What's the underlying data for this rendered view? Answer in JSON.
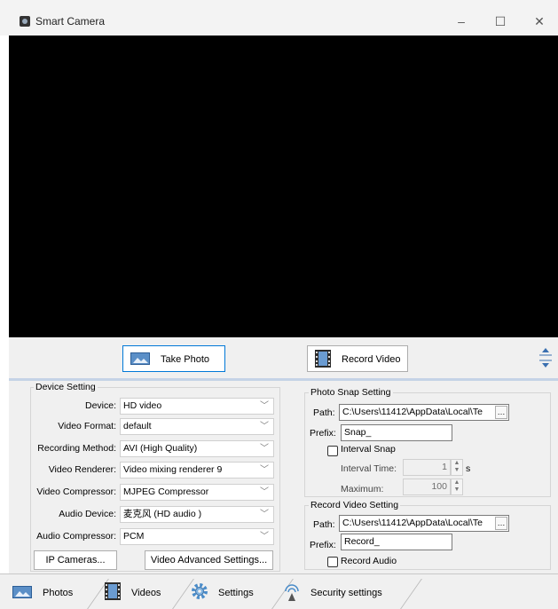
{
  "window": {
    "title": "Smart Camera",
    "minimize_glyph": "–",
    "maximize_glyph": "☐",
    "close_glyph": "✕"
  },
  "actions": {
    "take_photo": "Take Photo",
    "record_video": "Record Video"
  },
  "device_setting": {
    "group_title": "Device Setting",
    "rows": [
      {
        "label": "Device:",
        "value": "HD video"
      },
      {
        "label": "Video Format:",
        "value": "default"
      },
      {
        "label": "Recording Method:",
        "value": "AVI (High Quality)"
      },
      {
        "label": "Video Renderer:",
        "value": "Video mixing renderer 9"
      },
      {
        "label": "Video Compressor:",
        "value": "MJPEG Compressor"
      },
      {
        "label": "Audio Device:",
        "value": "麦克风 (HD audio )"
      },
      {
        "label": "Audio Compressor:",
        "value": "PCM"
      }
    ],
    "ip_cameras_button": "IP Cameras...",
    "video_advanced_button": "Video Advanced Settings..."
  },
  "photo_snap": {
    "group_title": "Photo Snap Setting",
    "path_label": "Path:",
    "path_value": "C:\\Users\\11412\\AppData\\Local\\Te",
    "prefix_label": "Prefix:",
    "prefix_value": "Snap_",
    "interval_snap_label": "Interval Snap",
    "interval_time_label": "Interval Time:",
    "interval_time_value": "1",
    "interval_time_unit": "s",
    "maximum_label": "Maximum:",
    "maximum_value": "100",
    "browse_label": "…"
  },
  "record_video": {
    "group_title": "Record Video Setting",
    "path_label": "Path:",
    "path_value": "C:\\Users\\11412\\AppData\\Local\\Te",
    "prefix_label": "Prefix:",
    "prefix_value": "Record_",
    "record_audio_label": "Record Audio",
    "browse_label": "…"
  },
  "tabs": [
    {
      "label": "Photos",
      "icon": "photo-icon"
    },
    {
      "label": "Videos",
      "icon": "film-icon"
    },
    {
      "label": "Settings",
      "icon": "gear-icon"
    },
    {
      "label": "Security settings",
      "icon": "security-icon"
    }
  ],
  "colors": {
    "video_bg": "#000000",
    "accent": "#0078d7",
    "panel_bg": "#f0f0f0"
  }
}
